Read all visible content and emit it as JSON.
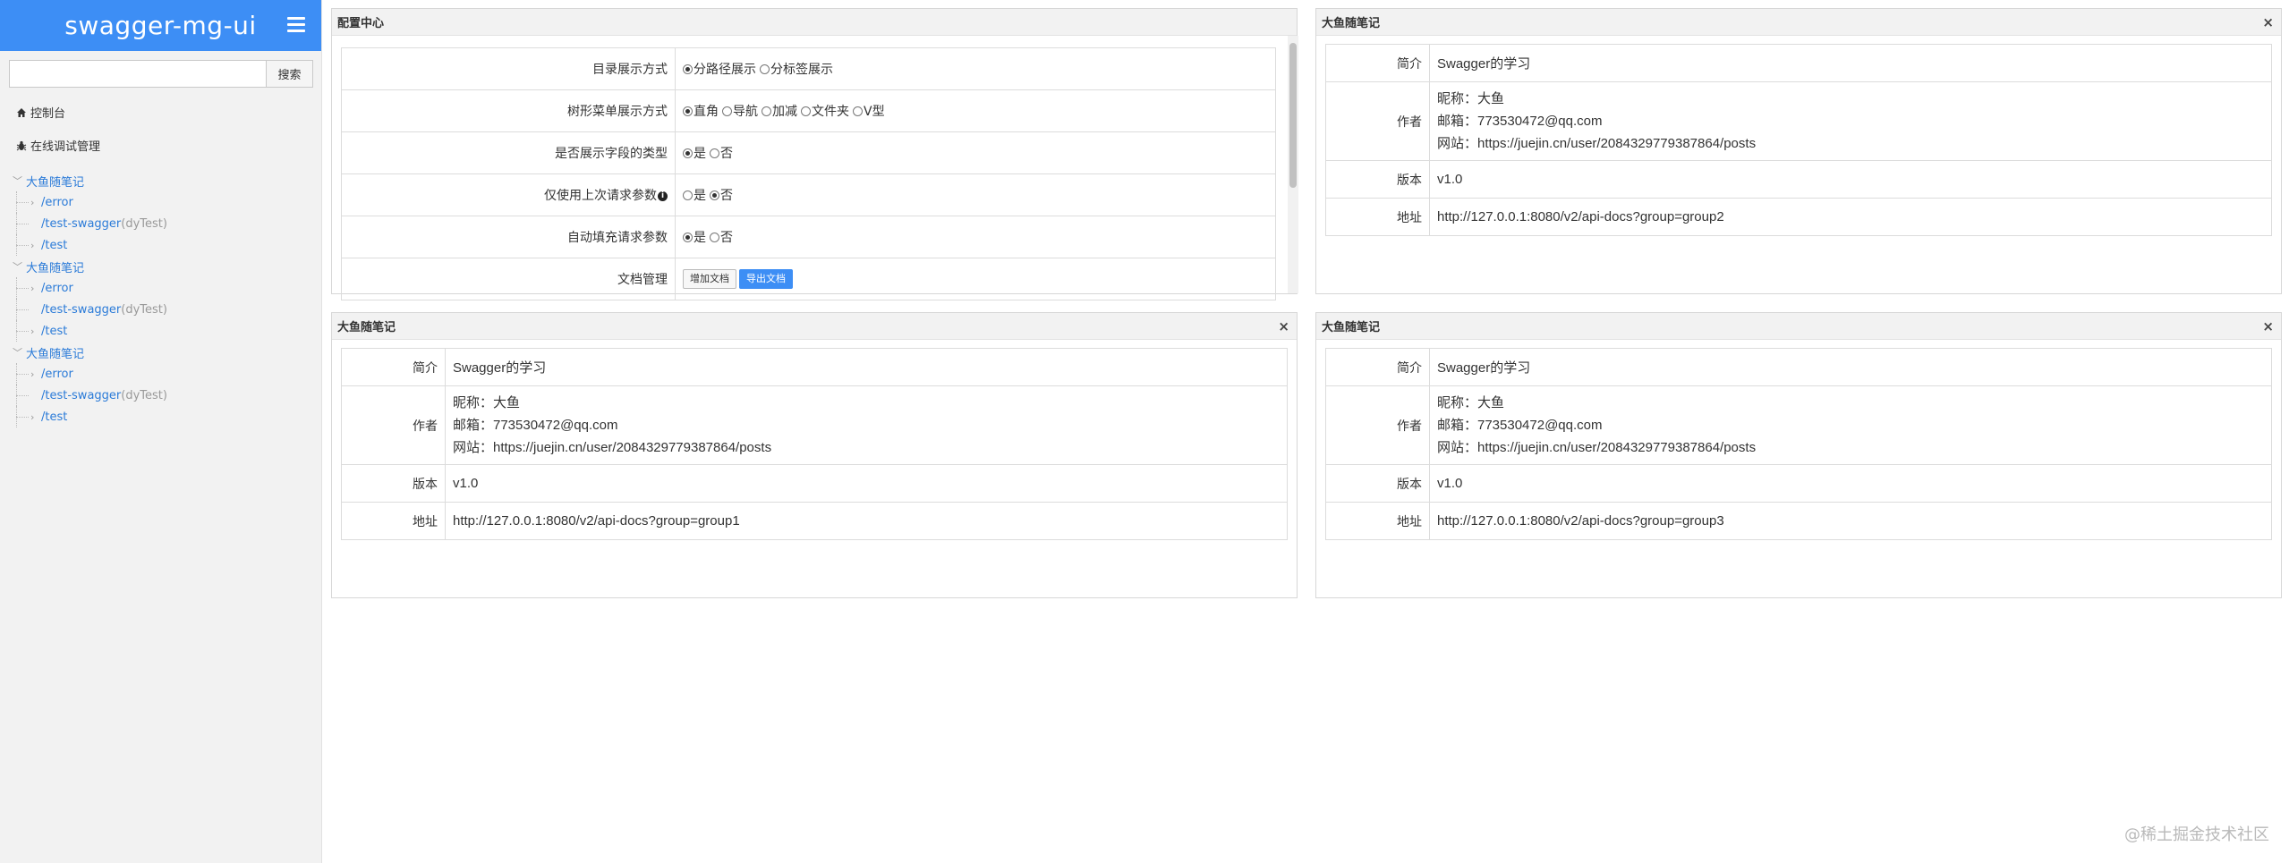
{
  "brand": {
    "title": "swagger-mg-ui"
  },
  "search": {
    "placeholder": "",
    "button_label": "搜索"
  },
  "nav": {
    "console": "控制台",
    "debug": "在线调试管理"
  },
  "tree": [
    {
      "label": "大鱼随笔记",
      "items": [
        {
          "path": "/error",
          "sub": ""
        },
        {
          "path": "/test-swagger",
          "sub": "(dyTest)"
        },
        {
          "path": "/test",
          "sub": ""
        }
      ]
    },
    {
      "label": "大鱼随笔记",
      "items": [
        {
          "path": "/error",
          "sub": ""
        },
        {
          "path": "/test-swagger",
          "sub": "(dyTest)"
        },
        {
          "path": "/test",
          "sub": ""
        }
      ]
    },
    {
      "label": "大鱼随笔记",
      "items": [
        {
          "path": "/error",
          "sub": ""
        },
        {
          "path": "/test-swagger",
          "sub": "(dyTest)"
        },
        {
          "path": "/test",
          "sub": ""
        }
      ]
    }
  ],
  "config": {
    "title": "配置中心",
    "rows": [
      {
        "label": "目录展示方式",
        "options": [
          {
            "text": "分路径展示",
            "checked": true
          },
          {
            "text": "分标签展示",
            "checked": false
          }
        ]
      },
      {
        "label": "树形菜单展示方式",
        "options": [
          {
            "text": "直角",
            "checked": true
          },
          {
            "text": "导航",
            "checked": false
          },
          {
            "text": "加减",
            "checked": false
          },
          {
            "text": "文件夹",
            "checked": false
          },
          {
            "text": "V型",
            "checked": false
          }
        ]
      },
      {
        "label": "是否展示字段的类型",
        "options": [
          {
            "text": "是",
            "checked": true
          },
          {
            "text": "否",
            "checked": false
          }
        ]
      },
      {
        "label": "仅使用上次请求参数",
        "info": true,
        "options": [
          {
            "text": "是",
            "checked": false
          },
          {
            "text": "否",
            "checked": true
          }
        ]
      },
      {
        "label": "自动填充请求参数",
        "options": [
          {
            "text": "是",
            "checked": true
          },
          {
            "text": "否",
            "checked": false
          }
        ]
      }
    ],
    "doc_manage": {
      "label": "文档管理",
      "add_button": "增加文档",
      "export_button": "导出文档"
    }
  },
  "panels": [
    {
      "title": "大鱼随笔记",
      "intro_label": "简介",
      "intro": "Swagger的学习",
      "author_label": "作者",
      "nickname": "昵称：大鱼",
      "email": "邮箱：773530472@qq.com",
      "website": "网站：https://juejin.cn/user/2084329779387864/posts",
      "version_label": "版本",
      "version": "v1.0",
      "url_label": "地址",
      "url": "http://127.0.0.1:8080/v2/api-docs?group=group2"
    },
    {
      "title": "大鱼随笔记",
      "intro_label": "简介",
      "intro": "Swagger的学习",
      "author_label": "作者",
      "nickname": "昵称：大鱼",
      "email": "邮箱：773530472@qq.com",
      "website": "网站：https://juejin.cn/user/2084329779387864/posts",
      "version_label": "版本",
      "version": "v1.0",
      "url_label": "地址",
      "url": "http://127.0.0.1:8080/v2/api-docs?group=group1"
    },
    {
      "title": "大鱼随笔记",
      "intro_label": "简介",
      "intro": "Swagger的学习",
      "author_label": "作者",
      "nickname": "昵称：大鱼",
      "email": "邮箱：773530472@qq.com",
      "website": "网站：https://juejin.cn/user/2084329779387864/posts",
      "version_label": "版本",
      "version": "v1.0",
      "url_label": "地址",
      "url": "http://127.0.0.1:8080/v2/api-docs?group=group3"
    }
  ],
  "close_glyph": "×",
  "watermark": "@稀土掘金技术社区",
  "colors": {
    "brand": "#3d8ef5",
    "link": "#2b7bd8",
    "sidebar_bg": "#f2f2f2"
  }
}
